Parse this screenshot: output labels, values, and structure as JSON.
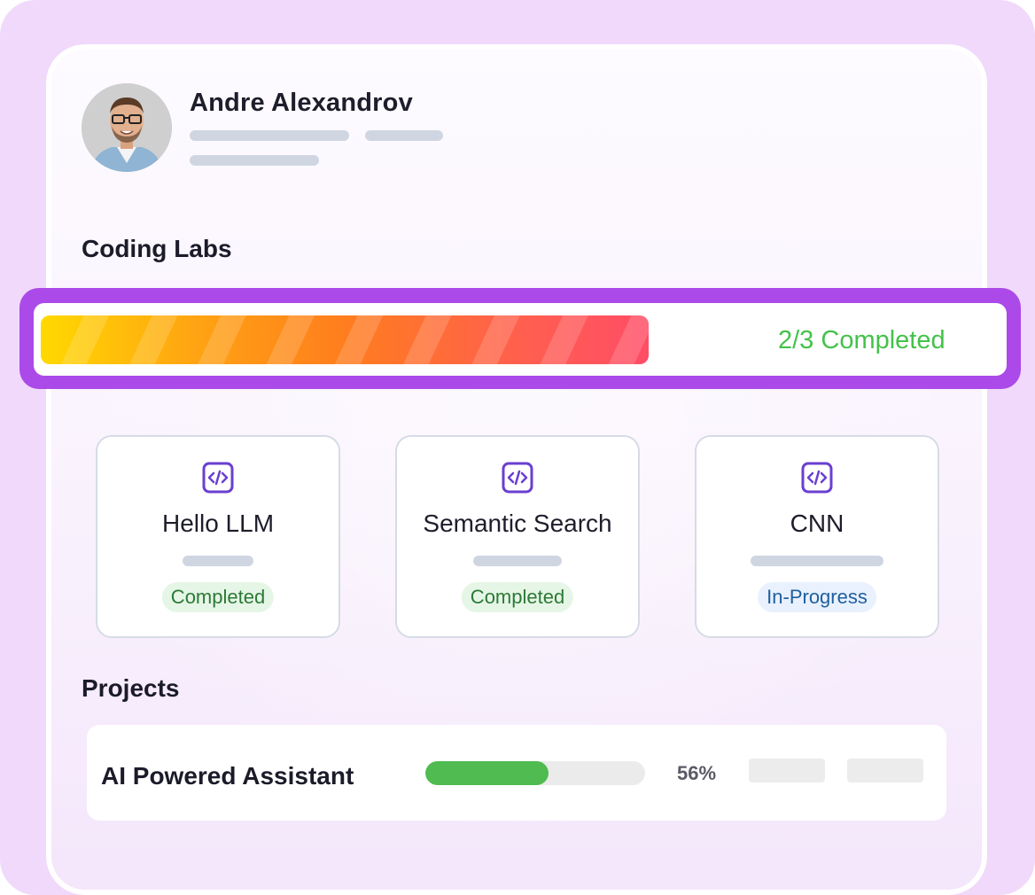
{
  "profile": {
    "name": "Andre Alexandrov"
  },
  "labs": {
    "section_title": "Coding Labs",
    "completed": 2,
    "total": 3,
    "status_text": "2/3 Completed",
    "cards": [
      {
        "title": "Hello LLM",
        "status": "Completed",
        "icon": "code-icon"
      },
      {
        "title": "Semantic Search",
        "status": "Completed",
        "icon": "code-icon"
      },
      {
        "title": "CNN",
        "status": "In-Progress",
        "icon": "code-icon"
      }
    ]
  },
  "projects": {
    "section_title": "Projects",
    "items": [
      {
        "name": "AI Powered Assistant",
        "progress_percent": 56,
        "progress_label": "56%"
      }
    ]
  },
  "colors": {
    "frame_accent": "#ab4ae8",
    "completed_green": "#44c24a",
    "progress_fill": "#4fbb50",
    "icon_purple": "#6b3fd1"
  }
}
